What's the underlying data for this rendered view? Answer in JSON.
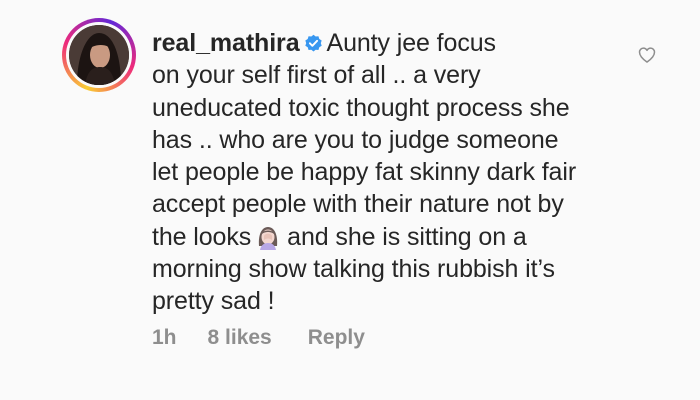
{
  "comment": {
    "username": "real_mathira",
    "verified_icon": "verified-badge-icon",
    "text_before_emoji": "Aunty jee focus\non your self first of all .. a very\nuneducated toxic thought process she\nhas .. who are you to judge someone\nlet people be happy fat skinny dark fair\naccept people with their nature not by\nthe looks",
    "emoji_icon": "woman-facepalming-icon",
    "text_after_emoji": "and she is sitting on a\nmorning show talking this rubbish it’s\npretty sad !",
    "time": "1h",
    "likes": "8 likes",
    "reply_label": "Reply",
    "like_icon": "heart-outline-icon"
  },
  "colors": {
    "background": "#fafafa",
    "text": "#262626",
    "meta": "#8e8e8e",
    "verified": "#3897f0"
  }
}
